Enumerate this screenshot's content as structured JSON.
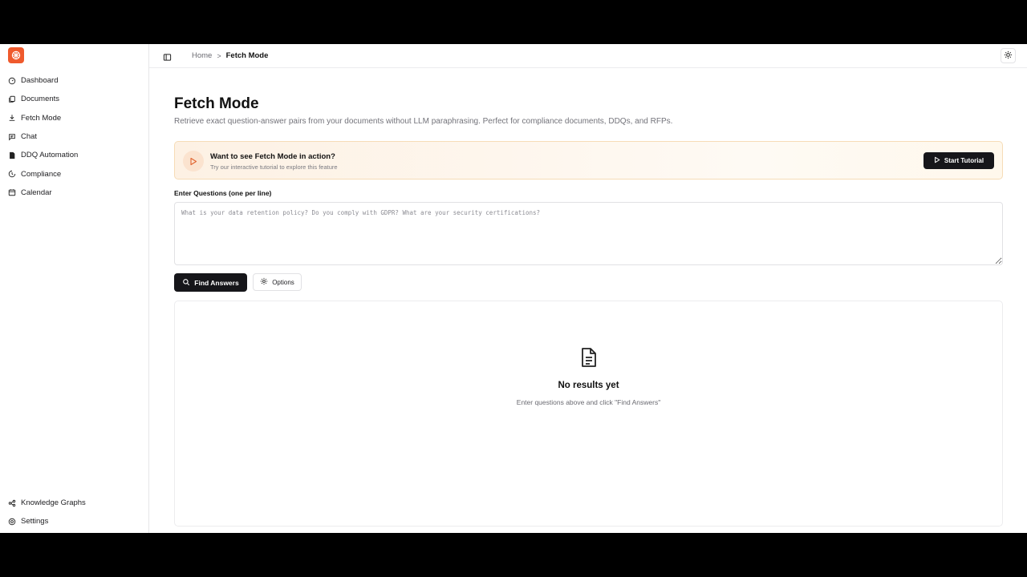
{
  "colors": {
    "brand": "#ef5a2d",
    "primary_button": "#16161a",
    "banner_bg": "#fdf1e4",
    "banner_border": "#f6dcb7"
  },
  "sidebar": {
    "logo_icon": "brain-logo-icon",
    "items": [
      {
        "label": "Dashboard",
        "icon": "dashboard-icon"
      },
      {
        "label": "Documents",
        "icon": "documents-icon"
      },
      {
        "label": "Fetch Mode",
        "icon": "download-icon"
      },
      {
        "label": "Chat",
        "icon": "chat-icon"
      },
      {
        "label": "DDQ Automation",
        "icon": "file-lock-icon"
      },
      {
        "label": "Compliance",
        "icon": "shield-icon"
      },
      {
        "label": "Calendar",
        "icon": "calendar-icon"
      }
    ],
    "bottom_items": [
      {
        "label": "Knowledge Graphs",
        "icon": "graph-icon"
      },
      {
        "label": "Settings",
        "icon": "gear-icon"
      }
    ]
  },
  "header": {
    "breadcrumb": {
      "home": "Home",
      "separator": ">",
      "current": "Fetch Mode"
    },
    "theme_icon": "sun-icon"
  },
  "page": {
    "title": "Fetch Mode",
    "subtitle": "Retrieve exact question-answer pairs from your documents without LLM paraphrasing. Perfect for compliance documents, DDQs, and RFPs."
  },
  "banner": {
    "title": "Want to see Fetch Mode in action?",
    "subtitle": "Try our interactive tutorial to explore this feature",
    "button_label": "Start Tutorial"
  },
  "questions": {
    "label": "Enter Questions (one per line)",
    "placeholder": "What is your data retention policy? Do you comply with GDPR? What are your security certifications?",
    "value": ""
  },
  "actions": {
    "find_label": "Find Answers",
    "options_label": "Options"
  },
  "results": {
    "empty_title": "No results yet",
    "empty_subtitle": "Enter questions above and click \"Find Answers\""
  }
}
